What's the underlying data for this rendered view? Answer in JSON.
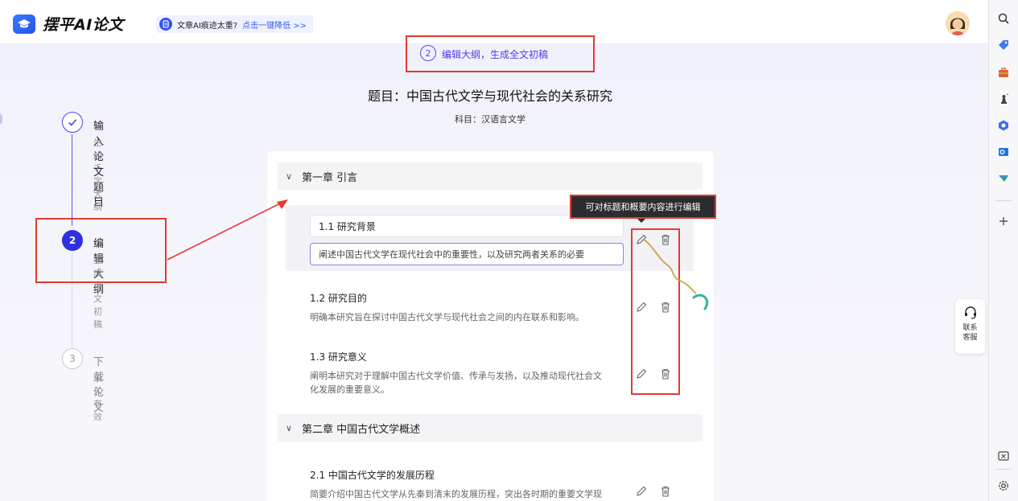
{
  "header": {
    "brand": "摆平AI论文",
    "notice_text": "文章AI痕迹太重?",
    "notice_link": "点击一键降低 >>"
  },
  "callout": {
    "step_number": "2",
    "text": "编辑大纲，生成全文初稿"
  },
  "page": {
    "title": "题目：中国古代文学与现代社会的关系研究",
    "subject": "科目：汉语言文学"
  },
  "steps": [
    {
      "title": "输入论文题目",
      "subtitle": "生成千字大纲",
      "state": "done"
    },
    {
      "number": "2",
      "title": "编辑大纲",
      "subtitle": "生成论文初稿",
      "state": "active"
    },
    {
      "number": "3",
      "title": "下载论文",
      "subtitle": "永久有效",
      "state": "todo"
    }
  ],
  "outline": {
    "chapters": [
      {
        "title": "第一章 引言",
        "sections": [
          {
            "title": "1.1 研究背景",
            "desc": "阐述中国古代文学在现代社会中的重要性，以及研究两者关系的必要",
            "editing": true
          },
          {
            "title": "1.2 研究目的",
            "desc": "明确本研究旨在探讨中国古代文学与现代社会之间的内在联系和影响。"
          },
          {
            "title": "1.3 研究意义",
            "desc_line1": "阐明本研究对于理解中国古代文学价值、传承与发扬，以及推动现代社会文",
            "desc_line2": "化发展的重要意义。"
          }
        ]
      },
      {
        "title": "第二章 中国古代文学概述",
        "sections": [
          {
            "title": "2.1 中国古代文学的发展历程",
            "desc": "简要介绍中国古代文学从先秦到清末的发展历程，突出各时期的重要文学现"
          }
        ]
      }
    ]
  },
  "tooltip": {
    "text": "可对标题和概要内容进行编辑"
  },
  "support": {
    "label": "联系客服"
  },
  "colors": {
    "primary": "#2f2fe0",
    "accent": "#4d3ce8",
    "annotation": "#e33a32"
  },
  "icons": [
    "search-icon",
    "tag-icon",
    "briefcase-icon",
    "chess-icon",
    "copilot-icon",
    "outlook-icon",
    "send-icon",
    "plus-icon",
    "edit-icon",
    "delete-icon",
    "headset-icon",
    "screenshot-icon",
    "settings-icon"
  ]
}
